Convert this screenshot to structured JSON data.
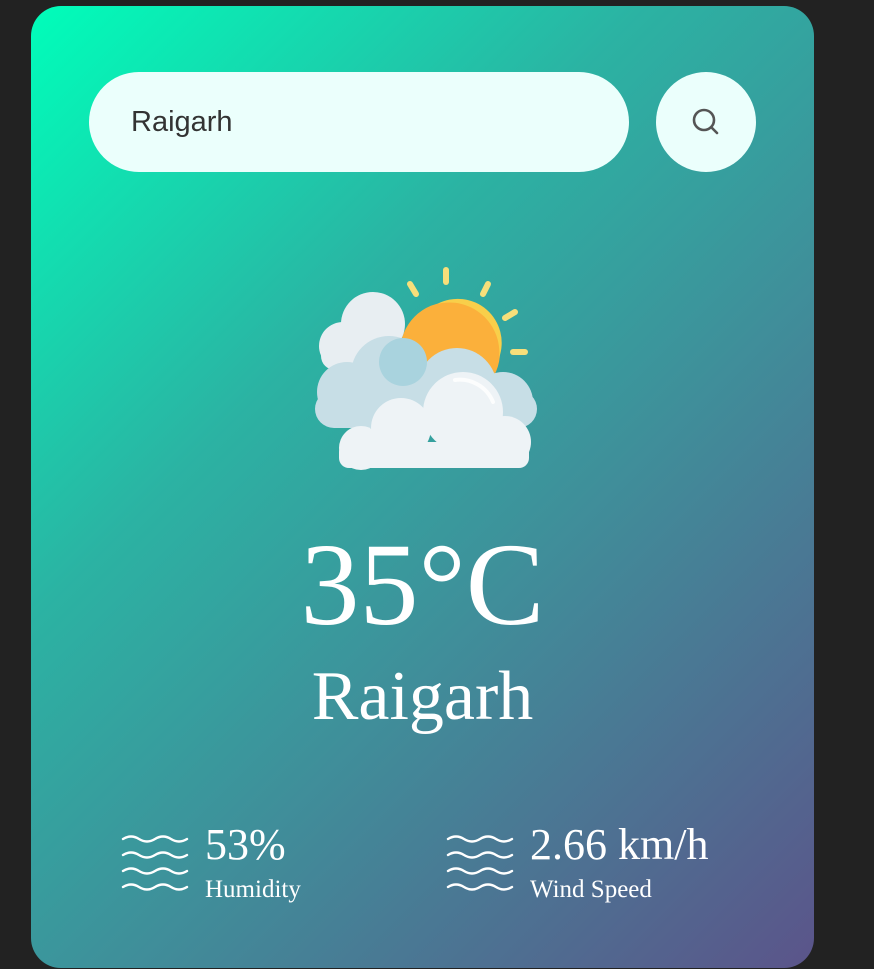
{
  "search": {
    "value": "Raigarh",
    "button_icon": "search-icon"
  },
  "weather": {
    "icon": "partly-cloudy-sun-icon",
    "temperature": "35°C",
    "city": "Raigarh"
  },
  "details": {
    "humidity": {
      "icon": "waves-icon",
      "value": "53%",
      "label": "Humidity"
    },
    "wind": {
      "icon": "waves-icon",
      "value": "2.66 km/h",
      "label": "Wind Speed"
    }
  },
  "colors": {
    "page_background": "#222222",
    "gradient_start": "#00feba",
    "gradient_end": "#5b548a",
    "input_background": "#ebfffc",
    "text": "#ffffff"
  }
}
